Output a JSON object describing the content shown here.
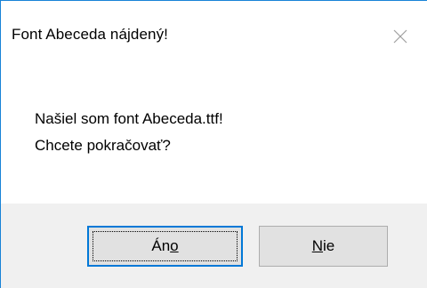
{
  "window": {
    "title": "Font Abeceda nájdený!"
  },
  "message": {
    "line1": "Našiel som font Abeceda.ttf!",
    "line2": "Chcete pokračovať?"
  },
  "buttons": {
    "yes": {
      "prefix": "Án",
      "mnemonic": "o",
      "suffix": ""
    },
    "no": {
      "prefix": "",
      "mnemonic": "N",
      "suffix": "ie"
    }
  },
  "icons": {
    "close": "close-icon"
  },
  "colors": {
    "accent": "#0078d7",
    "border": "#1883d7",
    "footer": "#f0f0f0"
  }
}
